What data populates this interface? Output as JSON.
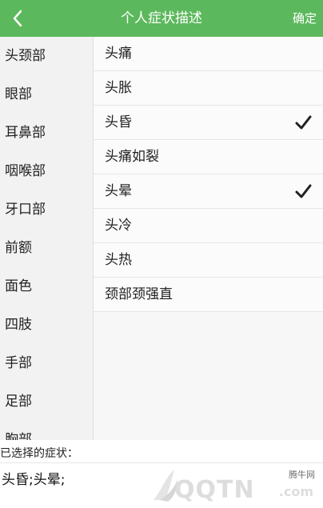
{
  "header": {
    "title": "个人症状描述",
    "confirm_label": "确定",
    "back_icon": "chevron-left-icon",
    "bg_color": "#5cb85c"
  },
  "categories": [
    {
      "label": "头颈部"
    },
    {
      "label": "眼部"
    },
    {
      "label": "耳鼻部"
    },
    {
      "label": "咽喉部"
    },
    {
      "label": "牙口部"
    },
    {
      "label": "前额"
    },
    {
      "label": "面色"
    },
    {
      "label": "四肢"
    },
    {
      "label": "手部"
    },
    {
      "label": "足部"
    },
    {
      "label": "胸部"
    }
  ],
  "symptoms": [
    {
      "label": "头痛",
      "checked": false
    },
    {
      "label": "头胀",
      "checked": false
    },
    {
      "label": "头昏",
      "checked": true
    },
    {
      "label": "头痛如裂",
      "checked": false
    },
    {
      "label": "头晕",
      "checked": true
    },
    {
      "label": "头冷",
      "checked": false
    },
    {
      "label": "头热",
      "checked": false
    },
    {
      "label": "颈部颈强直",
      "checked": false
    }
  ],
  "selected": {
    "label": "已选择的症状：",
    "value": "头昏;头晕;"
  },
  "watermark": {
    "small_text": "腾牛网",
    "big_text": "QQTN",
    "suffix": ".com"
  }
}
